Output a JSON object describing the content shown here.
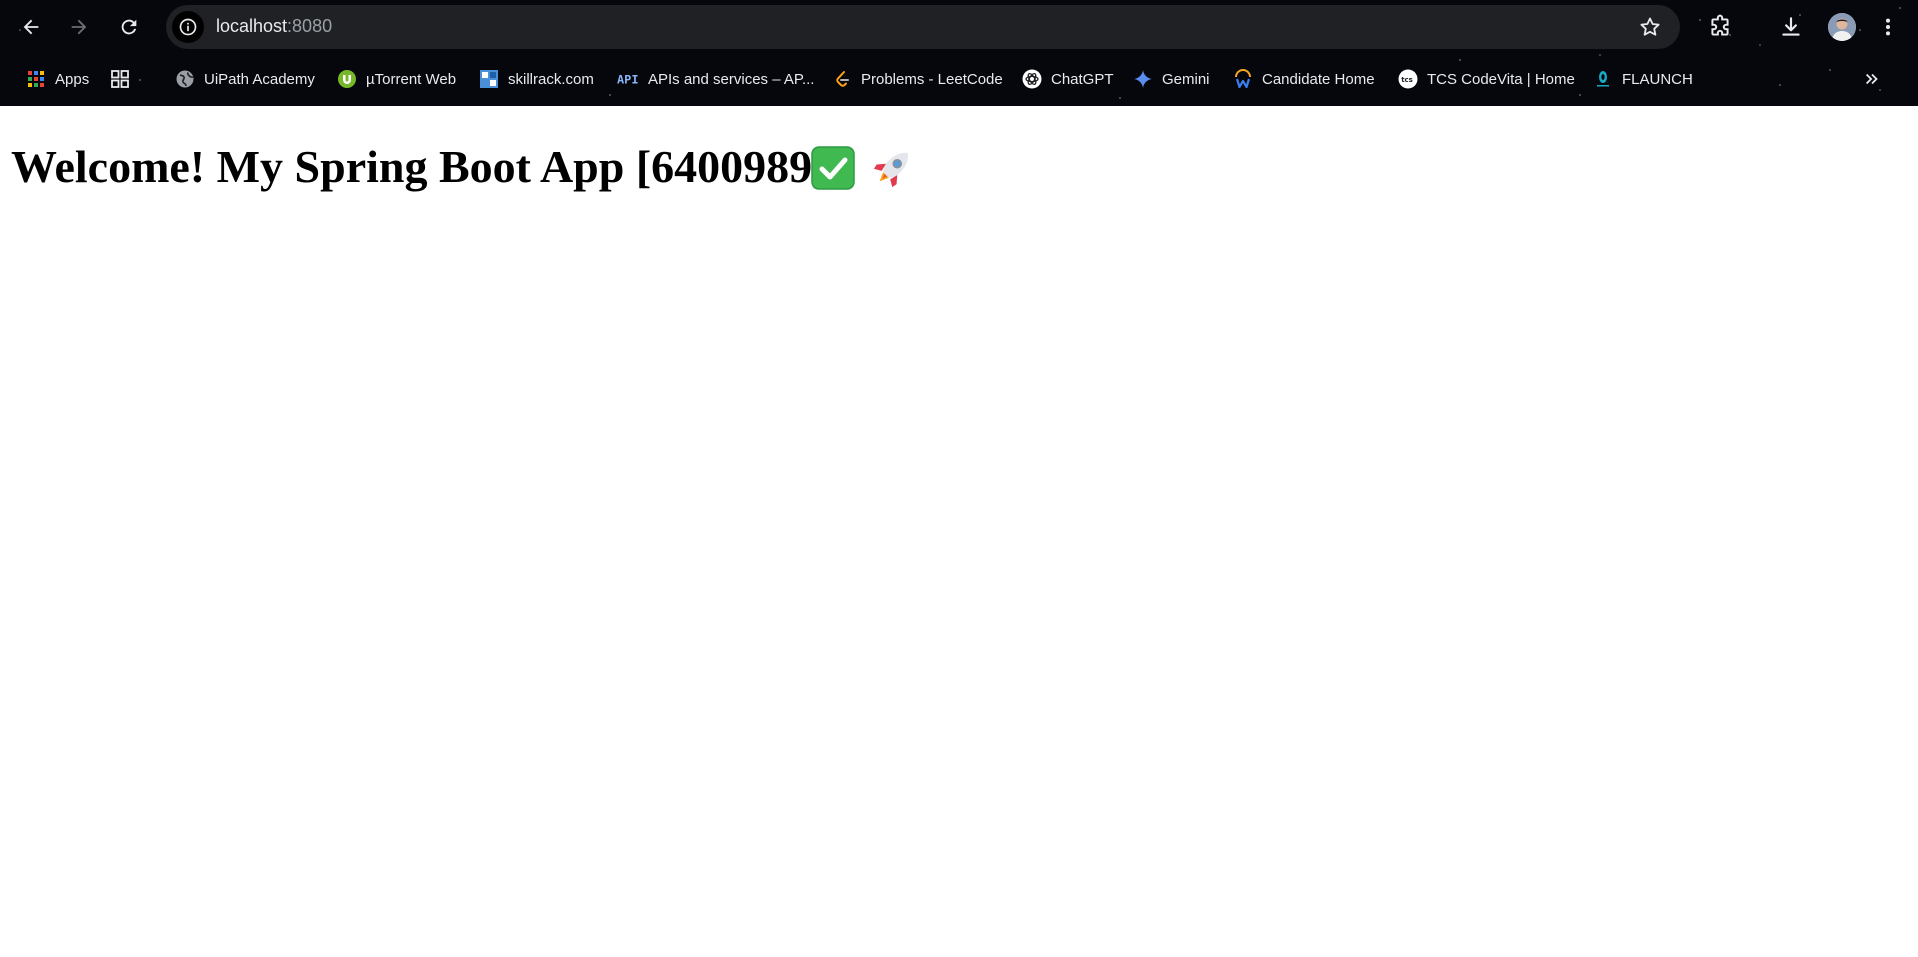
{
  "browser": {
    "url_host": "localhost",
    "url_port": ":8080",
    "bookmarks": [
      {
        "label": "Apps",
        "icon": "apps-grid-icon"
      },
      {
        "label": "",
        "icon": "tab-groups-icon"
      },
      {
        "label": "UiPath Academy",
        "icon": "globe-icon"
      },
      {
        "label": "µTorrent Web",
        "icon": "utorrent-icon"
      },
      {
        "label": "skillrack.com",
        "icon": "skillrack-icon"
      },
      {
        "label": "APIs and services – AP...",
        "icon": "api-icon"
      },
      {
        "label": "Problems - LeetCode",
        "icon": "leetcode-icon"
      },
      {
        "label": "ChatGPT",
        "icon": "chatgpt-icon"
      },
      {
        "label": "Gemini",
        "icon": "gemini-sparkle-icon"
      },
      {
        "label": "Candidate Home",
        "icon": "workday-icon"
      },
      {
        "label": "TCS CodeVita | Home",
        "icon": "tcs-icon"
      },
      {
        "label": "FLAUNCH",
        "icon": "flaunch-icon"
      }
    ]
  },
  "page": {
    "heading": "Welcome! My Spring Boot App [6400989]"
  },
  "colors": {
    "chrome_background": "#05070c",
    "omnibox_background": "#202124",
    "toolbar_text": "#e8eaed",
    "url_port_text": "#9aa0a6",
    "page_background": "#ffffff",
    "heading_text": "#000000",
    "check_emoji": "#3fb950",
    "rocket_emoji": "#e4e6eb"
  }
}
